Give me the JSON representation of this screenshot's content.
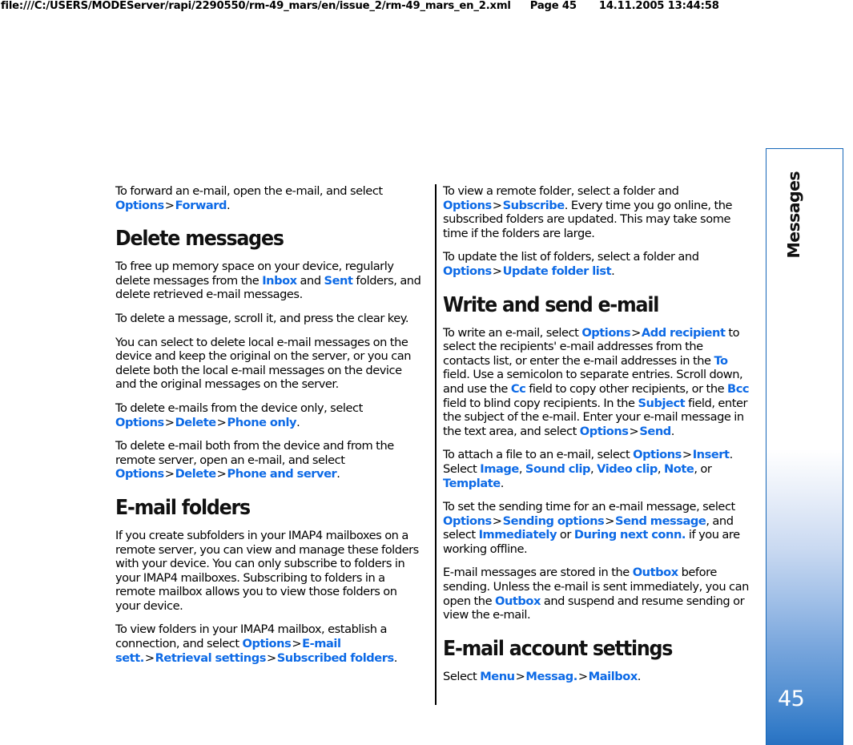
{
  "print_header": {
    "url": "file:///C:/USERS/MODEServer/rapi/2290550/rm-49_mars/en/issue_2/rm-49_mars_en_2.xml",
    "page_label": "Page 45",
    "timestamp": "14.11.2005 13:44:58"
  },
  "side_tab": {
    "chapter_label": "Messages",
    "page_number": "45",
    "border_color": "#1667b8",
    "gradient_end_color": "#2870c0"
  },
  "theme": {
    "ui_term_color": "#0d6ae6",
    "text_color": "#000000"
  },
  "left_column": {
    "blocks": [
      {
        "id": "p_forward",
        "type": "paragraph",
        "runs": [
          {
            "t": "text",
            "v": "To forward an e-mail, open the e-mail, and select "
          },
          {
            "t": "ui",
            "v": "Options"
          },
          {
            "t": "gt",
            "v": ">"
          },
          {
            "t": "ui",
            "v": "Forward"
          },
          {
            "t": "text",
            "v": "."
          }
        ]
      },
      {
        "id": "h_delete_messages",
        "type": "heading",
        "text": "Delete messages"
      },
      {
        "id": "p_free_memory",
        "type": "paragraph",
        "runs": [
          {
            "t": "text",
            "v": "To free up memory space on your device, regularly delete messages from the "
          },
          {
            "t": "ui",
            "v": "Inbox"
          },
          {
            "t": "text",
            "v": " and "
          },
          {
            "t": "ui",
            "v": "Sent"
          },
          {
            "t": "text",
            "v": " folders, and delete retrieved e-mail messages."
          }
        ]
      },
      {
        "id": "p_clear_key",
        "type": "paragraph",
        "runs": [
          {
            "t": "text",
            "v": "To delete a message, scroll it, and press the clear key."
          }
        ]
      },
      {
        "id": "p_local_or_server",
        "type": "paragraph",
        "runs": [
          {
            "t": "text",
            "v": "You can select to delete local e-mail messages on the device and keep the original on the server, or you can delete both the local e-mail messages on the device and the original messages on the server."
          }
        ]
      },
      {
        "id": "p_phone_only",
        "type": "paragraph",
        "runs": [
          {
            "t": "text",
            "v": "To delete e-mails from the device only, select "
          },
          {
            "t": "ui",
            "v": "Options"
          },
          {
            "t": "gt",
            "v": ">"
          },
          {
            "t": "ui",
            "v": "Delete"
          },
          {
            "t": "gt",
            "v": ">"
          },
          {
            "t": "ui",
            "v": "Phone only"
          },
          {
            "t": "text",
            "v": "."
          }
        ]
      },
      {
        "id": "p_phone_and_server",
        "type": "paragraph",
        "runs": [
          {
            "t": "text",
            "v": "To delete e-mail both from the device and from the remote server, open an e-mail, and select "
          },
          {
            "t": "ui",
            "v": "Options"
          },
          {
            "t": "gt",
            "v": ">"
          },
          {
            "t": "ui",
            "v": "Delete"
          },
          {
            "t": "gt",
            "v": ">"
          },
          {
            "t": "ui",
            "v": "Phone and server"
          },
          {
            "t": "text",
            "v": "."
          }
        ]
      },
      {
        "id": "h_email_folders",
        "type": "heading",
        "text": "E-mail folders"
      },
      {
        "id": "p_subfolders",
        "type": "paragraph",
        "runs": [
          {
            "t": "text",
            "v": "If you create subfolders in your IMAP4 mailboxes on a remote server, you can view and manage these folders with your device. You can only subscribe to folders in your IMAP4 mailboxes. Subscribing to folders in a remote mailbox allows you to view those folders on your device."
          }
        ]
      },
      {
        "id": "p_view_folders",
        "type": "paragraph",
        "runs": [
          {
            "t": "text",
            "v": "To view folders in your IMAP4 mailbox, establish a connection, and select "
          },
          {
            "t": "ui",
            "v": "Options"
          },
          {
            "t": "gt",
            "v": ">"
          },
          {
            "t": "ui",
            "v": "E-mail sett."
          },
          {
            "t": "gt",
            "v": ">"
          },
          {
            "t": "ui",
            "v": "Retrieval settings"
          },
          {
            "t": "gt",
            "v": ">"
          },
          {
            "t": "ui",
            "v": "Subscribed folders"
          },
          {
            "t": "text",
            "v": "."
          }
        ]
      }
    ]
  },
  "right_column": {
    "blocks": [
      {
        "id": "p_subscribe",
        "type": "paragraph",
        "runs": [
          {
            "t": "text",
            "v": "To view a remote folder, select a folder and "
          },
          {
            "t": "ui",
            "v": "Options"
          },
          {
            "t": "gt",
            "v": ">"
          },
          {
            "t": "ui",
            "v": "Subscribe"
          },
          {
            "t": "text",
            "v": ". Every time you go online, the subscribed folders are updated. This may take some time if the folders are large."
          }
        ]
      },
      {
        "id": "p_update_folder_list",
        "type": "paragraph",
        "runs": [
          {
            "t": "text",
            "v": "To update the list of folders, select a folder and "
          },
          {
            "t": "ui",
            "v": "Options"
          },
          {
            "t": "gt",
            "v": ">"
          },
          {
            "t": "ui",
            "v": "Update folder list"
          },
          {
            "t": "text",
            "v": "."
          }
        ]
      },
      {
        "id": "h_write_and_send",
        "type": "heading",
        "text": "Write and send e-mail"
      },
      {
        "id": "p_write_email",
        "type": "paragraph",
        "runs": [
          {
            "t": "text",
            "v": "To write an e-mail, select "
          },
          {
            "t": "ui",
            "v": "Options"
          },
          {
            "t": "gt",
            "v": ">"
          },
          {
            "t": "ui",
            "v": "Add recipient"
          },
          {
            "t": "text",
            "v": " to select the recipients' e-mail addresses from the contacts list, or enter the e-mail addresses in the "
          },
          {
            "t": "ui",
            "v": "To"
          },
          {
            "t": "text",
            "v": " field. Use a semicolon to separate entries. Scroll down, and use the "
          },
          {
            "t": "ui",
            "v": "Cc"
          },
          {
            "t": "text",
            "v": " field to copy other recipients, or the "
          },
          {
            "t": "ui",
            "v": "Bcc"
          },
          {
            "t": "text",
            "v": " field to blind copy recipients. In the "
          },
          {
            "t": "ui",
            "v": "Subject"
          },
          {
            "t": "text",
            "v": " field, enter the subject of the e-mail. Enter your e-mail message in the text area, and select "
          },
          {
            "t": "ui",
            "v": "Options"
          },
          {
            "t": "gt",
            "v": ">"
          },
          {
            "t": "ui",
            "v": "Send"
          },
          {
            "t": "text",
            "v": "."
          }
        ]
      },
      {
        "id": "p_attach_file",
        "type": "paragraph",
        "runs": [
          {
            "t": "text",
            "v": "To attach a file to an e-mail, select "
          },
          {
            "t": "ui",
            "v": "Options"
          },
          {
            "t": "gt",
            "v": ">"
          },
          {
            "t": "ui",
            "v": "Insert"
          },
          {
            "t": "text",
            "v": ". Select "
          },
          {
            "t": "ui",
            "v": "Image"
          },
          {
            "t": "text",
            "v": ", "
          },
          {
            "t": "ui",
            "v": "Sound clip"
          },
          {
            "t": "text",
            "v": ", "
          },
          {
            "t": "ui",
            "v": "Video clip"
          },
          {
            "t": "text",
            "v": ", "
          },
          {
            "t": "ui",
            "v": "Note"
          },
          {
            "t": "text",
            "v": ", or "
          },
          {
            "t": "ui",
            "v": "Template"
          },
          {
            "t": "text",
            "v": "."
          }
        ]
      },
      {
        "id": "p_sending_time",
        "type": "paragraph",
        "runs": [
          {
            "t": "text",
            "v": "To set the sending time for an e-mail message, select "
          },
          {
            "t": "ui",
            "v": "Options"
          },
          {
            "t": "gt",
            "v": ">"
          },
          {
            "t": "ui",
            "v": "Sending options"
          },
          {
            "t": "gt",
            "v": ">"
          },
          {
            "t": "ui",
            "v": "Send message"
          },
          {
            "t": "text",
            "v": ", and select "
          },
          {
            "t": "ui",
            "v": "Immediately"
          },
          {
            "t": "text",
            "v": " or "
          },
          {
            "t": "ui",
            "v": "During next conn."
          },
          {
            "t": "text",
            "v": " if you are working offline."
          }
        ]
      },
      {
        "id": "p_outbox",
        "type": "paragraph",
        "runs": [
          {
            "t": "text",
            "v": "E-mail messages are stored in the "
          },
          {
            "t": "ui",
            "v": "Outbox"
          },
          {
            "t": "text",
            "v": " before sending. Unless the e-mail is sent immediately, you can open the "
          },
          {
            "t": "ui",
            "v": "Outbox"
          },
          {
            "t": "text",
            "v": " and suspend and resume sending or view the e-mail."
          }
        ]
      },
      {
        "id": "h_account_settings",
        "type": "heading",
        "text": "E-mail account settings"
      },
      {
        "id": "p_select_menu",
        "type": "paragraph",
        "runs": [
          {
            "t": "text",
            "v": "Select "
          },
          {
            "t": "ui",
            "v": "Menu"
          },
          {
            "t": "gt",
            "v": ">"
          },
          {
            "t": "ui",
            "v": "Messag."
          },
          {
            "t": "gt",
            "v": ">"
          },
          {
            "t": "ui",
            "v": "Mailbox"
          },
          {
            "t": "text",
            "v": "."
          }
        ]
      }
    ]
  }
}
